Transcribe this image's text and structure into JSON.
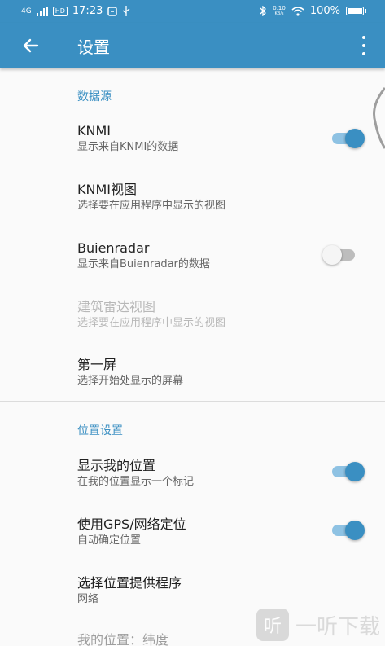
{
  "status_bar": {
    "network": "4G",
    "hd": "HD",
    "time": "17:23",
    "speed_value": "0.10",
    "speed_unit": "KB/s",
    "battery": "100%",
    "battery_level": 1.0
  },
  "toolbar": {
    "title": "设置"
  },
  "sections": {
    "data_source": {
      "header": "数据源",
      "knmi": {
        "title": "KNMI",
        "summary": "显示来自KNMI的数据",
        "enabled": true
      },
      "knmi_view": {
        "title": "KNMI视图",
        "summary": "选择要在应用程序中显示的视图"
      },
      "buienradar": {
        "title": "Buienradar",
        "summary": "显示来自Buienradar的数据",
        "enabled": false
      },
      "buienradar_view": {
        "title": "建筑雷达视图",
        "summary": "选择要在应用程序中显示的视图"
      },
      "first_screen": {
        "title": "第一屏",
        "summary": "选择开始处显示的屏幕"
      }
    },
    "location": {
      "header": "位置设置",
      "show_location": {
        "title": "显示我的位置",
        "summary": "在我的位置显示一个标记",
        "enabled": true
      },
      "use_gps": {
        "title": "使用GPS/网络定位",
        "summary": "自动确定位置",
        "enabled": true
      },
      "provider": {
        "title": "选择位置提供程序",
        "summary": "网络"
      },
      "my_location": {
        "title": "我的位置：纬度"
      }
    }
  },
  "watermark": {
    "logo_text": "听",
    "text": "一听下载"
  }
}
